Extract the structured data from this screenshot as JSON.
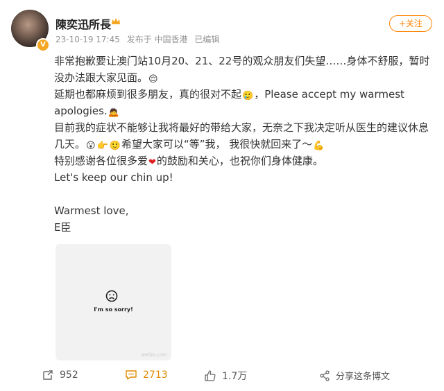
{
  "header": {
    "username": "陳奕迅所長",
    "timestamp": "23-10-19 17:45",
    "source": "发布于 中国香港",
    "edited": "已编辑",
    "follow_label": "+关注"
  },
  "post": {
    "line1": "非常抱歉要让澳门站10月20、21、22号的观众朋友们失望……身体不舒服，暂时",
    "line2": "没办法跟大家见面。",
    "line3": "延期也都麻烦到很多朋友，真的很对不起",
    "line3b": "，Please accept my warmest",
    "line4": "apologies.",
    "line5": "目前我的症状不能够让我将最好的带给大家，无奈之下我决定听从医生的建议休息",
    "line6a": "几天。",
    "line6b": "希望大家可以“等”我，  我很快就回来了～",
    "line7a": "特别感谢各位很多爱",
    "line7b": "的鼓励和关心，也祝你们身体健康。",
    "line8": "Let's keep our chin up!",
    "line9": "Warmest love,",
    "line10": "E臣"
  },
  "photo": {
    "caption": "I'm so sorry!",
    "watermark": "weibo.com"
  },
  "actions": {
    "reposts": "952",
    "comments": "2713",
    "likes": "1.7万",
    "share_label": "分享这条博文"
  },
  "colors": {
    "accent": "#ff8200",
    "comment_count": "#e08a00",
    "meta": "#939393"
  }
}
